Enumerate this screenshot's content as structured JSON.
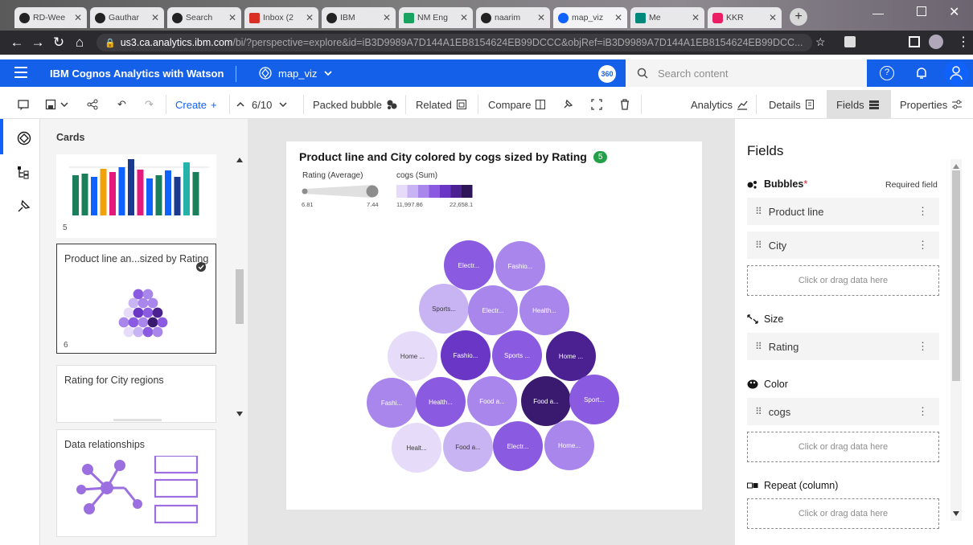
{
  "browser": {
    "tabs": [
      {
        "label": "RD-Wee",
        "icon": "github-icon"
      },
      {
        "label": "Gauthar",
        "icon": "github-icon"
      },
      {
        "label": "Search",
        "icon": "github-icon"
      },
      {
        "label": "Inbox (2",
        "icon": "gmail-icon"
      },
      {
        "label": "IBM",
        "icon": "github-icon"
      },
      {
        "label": "NM Eng",
        "icon": "drive-icon"
      },
      {
        "label": "naarim",
        "icon": "github-icon"
      },
      {
        "label": "map_viz",
        "icon": "cognos-icon"
      },
      {
        "label": "Me",
        "icon": "meet-icon"
      },
      {
        "label": "KKR",
        "icon": "app-icon"
      }
    ],
    "url_domain": "us3.ca.analytics.ibm.com",
    "url_rest": "/bi/?perspective=explore&id=iB3D9989A7D144A1EB8154624EB99DCCC&objRef=iB3D9989A7D144A1EB8154624EB99DCC..."
  },
  "appbar": {
    "brand": "IBM Cognos Analytics with Watson",
    "workspace": "map_viz",
    "badge": "360",
    "search_placeholder": "Search content"
  },
  "toolbar": {
    "create": "Create",
    "page_counter": "6/10",
    "viz_type": "Packed bubble",
    "related": "Related",
    "compare": "Compare",
    "analytics": "Analytics",
    "details": "Details",
    "fields": "Fields",
    "properties": "Properties"
  },
  "cards": {
    "header": "Cards",
    "card5_num": "5",
    "card6_title": "Product line an...sized by Rating",
    "card6_num": "6",
    "card7_title": "Rating for City regions",
    "card8_title": "Data relationships"
  },
  "viz": {
    "title": "Product line and City colored by cogs sized by Rating",
    "badge": "5",
    "legend_size_label": "Rating (Average)",
    "legend_size_min": "6.81",
    "legend_size_max": "7.44",
    "legend_color_label": "cogs (Sum)",
    "legend_color_min": "11,997.86",
    "legend_color_max": "22,658.1",
    "legend_colors": [
      "#e6dcfa",
      "#c9b4f3",
      "#a986ec",
      "#8a5ae0",
      "#6a36c6",
      "#4b2191",
      "#2e1558"
    ],
    "bubbles": [
      {
        "label": "Electr...",
        "color": "#8a5ae0"
      },
      {
        "label": "Fashio...",
        "color": "#a986ec"
      },
      {
        "label": "Sports...",
        "color": "#c9b4f3"
      },
      {
        "label": "Electr...",
        "color": "#a986ec"
      },
      {
        "label": "Health...",
        "color": "#a986ec"
      },
      {
        "label": "Home ...",
        "color": "#e6dcfa"
      },
      {
        "label": "Fashio...",
        "color": "#6a36c6"
      },
      {
        "label": "Sports ...",
        "color": "#8a5ae0"
      },
      {
        "label": "Home ...",
        "color": "#4b2191"
      },
      {
        "label": "Fashi...",
        "color": "#a986ec"
      },
      {
        "label": "Health...",
        "color": "#8a5ae0"
      },
      {
        "label": "Food a...",
        "color": "#a986ec"
      },
      {
        "label": "Food a...",
        "color": "#3a1a6e"
      },
      {
        "label": "Sport...",
        "color": "#8a5ae0"
      },
      {
        "label": "Healt...",
        "color": "#e6dcfa"
      },
      {
        "label": "Food a...",
        "color": "#c9b4f3"
      },
      {
        "label": "Electr...",
        "color": "#8a5ae0"
      },
      {
        "label": "Home...",
        "color": "#a986ec"
      }
    ]
  },
  "fields": {
    "title": "Fields",
    "bubbles_label": "Bubbles",
    "required_marker": "*",
    "required_field": "Required field",
    "slot_product_line": "Product line",
    "slot_city": "City",
    "drop_hint": "Click or drag data here",
    "size_label": "Size",
    "slot_rating": "Rating",
    "color_label": "Color",
    "slot_cogs": "cogs",
    "repeat_label": "Repeat (column)"
  }
}
